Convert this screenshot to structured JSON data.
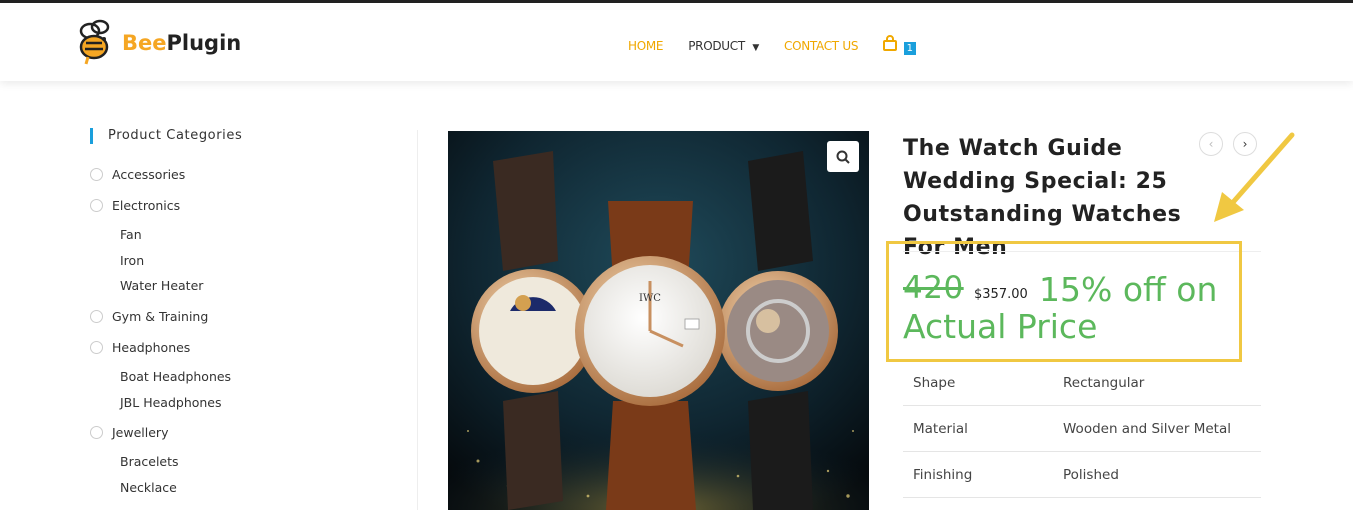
{
  "brand": {
    "name_part1": "Bee",
    "name_part2": "Plugin"
  },
  "nav": {
    "home": "HOME",
    "product": "PRODUCT",
    "contact": "CONTACT US",
    "cart_count": "1"
  },
  "sidebar": {
    "title": "Product Categories",
    "categories": [
      {
        "label": "Accessories"
      },
      {
        "label": "Electronics",
        "children": [
          "Fan",
          "Iron",
          "Water Heater"
        ]
      },
      {
        "label": "Gym & Training"
      },
      {
        "label": "Headphones",
        "children": [
          "Boat Headphones",
          "JBL Headphones"
        ]
      },
      {
        "label": "Jewellery",
        "children": [
          "Bracelets",
          "Necklace"
        ]
      }
    ]
  },
  "product": {
    "title": "The Watch Guide Wedding Special: 25 Outstanding Watches For Men",
    "old_price": "420",
    "new_price": "$357.00",
    "discount_line1": "15% off on",
    "discount_line2": "Actual Price",
    "attributes": [
      {
        "key": "Shape",
        "value": "Rectangular"
      },
      {
        "key": "Material",
        "value": "Wooden and Silver Metal"
      },
      {
        "key": "Finishing",
        "value": "Polished"
      }
    ],
    "watch_brand_label": "IWC"
  },
  "colors": {
    "accent_orange": "#f0a800",
    "accent_blue": "#1a9fdc",
    "price_green": "#5cb85c",
    "highlight_yellow": "#f0c842"
  }
}
